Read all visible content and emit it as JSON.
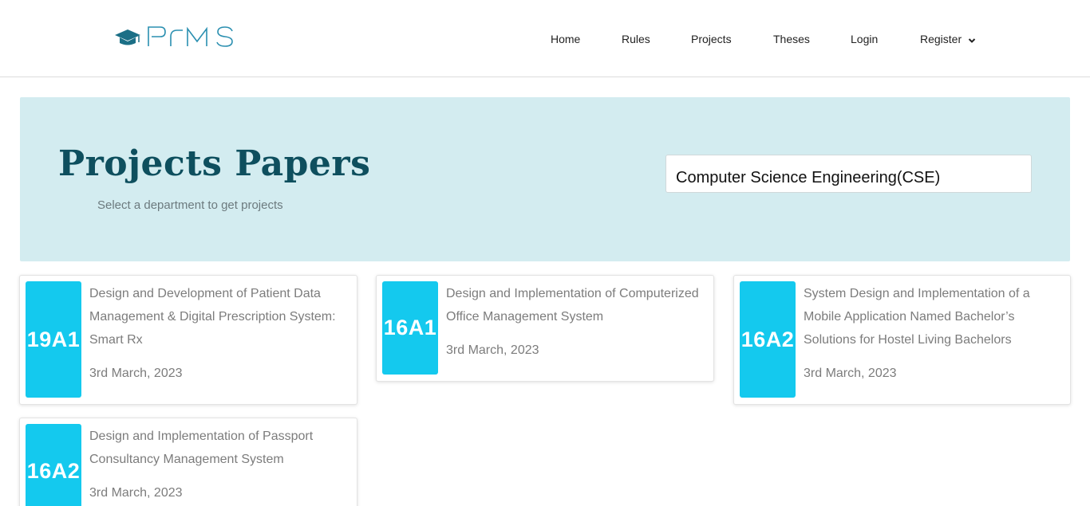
{
  "header": {
    "logo_text": "PRMS",
    "nav": [
      "Home",
      "Rules",
      "Projects",
      "Theses",
      "Login",
      "Register"
    ]
  },
  "hero": {
    "title": "Projects Papers",
    "subtitle": "Select a department to get projects",
    "department_selected": "Computer Science Engineering(CSE)"
  },
  "projects": [
    {
      "code": "19A1",
      "title": "Design and Development of Patient Data Management & Digital Prescription System: Smart Rx",
      "date": "3rd March, 2023"
    },
    {
      "code": "16A1",
      "title": "Design and Implementation of Computerized Office Management System",
      "date": "3rd March, 2023"
    },
    {
      "code": "16A2",
      "title": "System Design and Implementation of a Mobile Application Named Bachelor’s Solutions for Hostel Living Bachelors",
      "date": "3rd March, 2023"
    },
    {
      "code": "16A2",
      "title": "Design and Implementation of Passport Consultancy Management System",
      "date": "3rd March, 2023"
    }
  ],
  "colors": {
    "hero_bg": "#d3ecf0",
    "title": "#0e4f5e",
    "badge": "#14c9ee",
    "logo": "#1b6f86"
  },
  "icons": [
    "graduation-cap-icon",
    "chevron-down-icon"
  ]
}
